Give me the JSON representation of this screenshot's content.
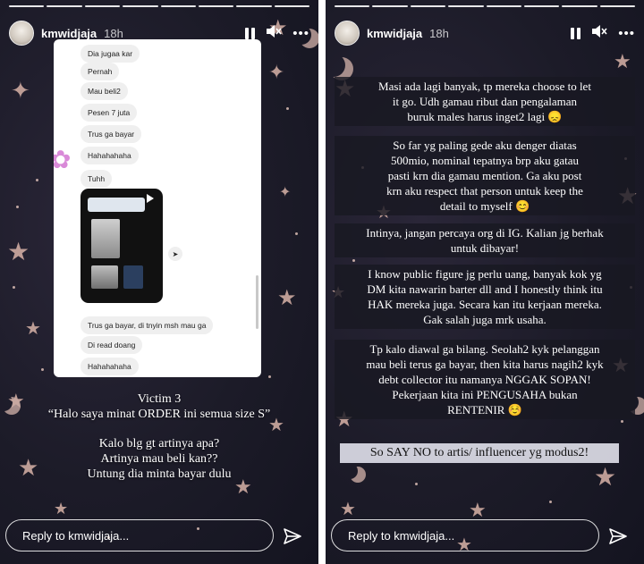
{
  "left_story": {
    "username": "kmwidjaja",
    "time": "18h",
    "progress_segments": 8,
    "chat_messages": [
      "Dia jugaa kar",
      "Pernah",
      "Mau beli2",
      "Pesen 7 juta",
      "Trus ga bayar",
      "Hahahahaha",
      "Tuhh",
      "Trus ga bayar, di tnyin msh mau ga",
      "Di read doang",
      "Hahahahaha"
    ],
    "caption_lines": [
      "Victim 3",
      "“Halo saya minat ORDER ini semua size S”",
      "",
      "Kalo blg gt artinya apa?",
      "Artinya mau beli kan??",
      "Untung dia minta bayar dulu"
    ],
    "reply_placeholder": "Reply to kmwidjaja..."
  },
  "right_story": {
    "username": "kmwidjaja",
    "time": "18h",
    "progress_segments": 8,
    "paragraphs": [
      {
        "lines": [
          "Masi ada lagi banyak, tp mereka choose to let",
          "it go. Udh gamau ribut dan pengalaman",
          "buruk males harus inget2 lagi 😞"
        ]
      },
      {
        "lines": [
          "So far yg paling gede aku denger diatas",
          "500mio, nominal tepatnya brp aku gatau",
          "pasti krn dia gamau mention. Ga aku post",
          "krn aku respect that person untuk keep the",
          "detail to myself 😊"
        ]
      },
      {
        "lines": [
          "Intinya, jangan percaya org di IG. Kalian jg berhak",
          "untuk dibayar!"
        ]
      },
      {
        "lines": [
          "I know public figure jg perlu uang, banyak kok yg",
          "DM kita nawarin barter dll and I honestly think itu",
          "HAK mereka juga. Secara kan itu kerjaan mereka.",
          "Gak salah juga mrk usaha."
        ]
      },
      {
        "lines": [
          "Tp kalo diawal ga bilang. Seolah2 kyk pelanggan",
          "mau beli terus ga bayar, then kita harus nagih2 kyk",
          "debt collector itu namanya NGGAK SOPAN!",
          "Pekerjaan kita ini PENGUSAHA bukan",
          "RENTENIR ☺️"
        ]
      }
    ],
    "highlight": "So SAY NO to artis/ influencer yg modus2!",
    "reply_placeholder": "Reply to kmwidjaja..."
  },
  "icons": {
    "pause": "pause-icon",
    "mute": "mute-icon",
    "more": "more-icon",
    "send": "send-icon"
  },
  "colors": {
    "background": "#1c1b28",
    "accent_stars": "#d9b3a8",
    "text": "#ffffff"
  }
}
